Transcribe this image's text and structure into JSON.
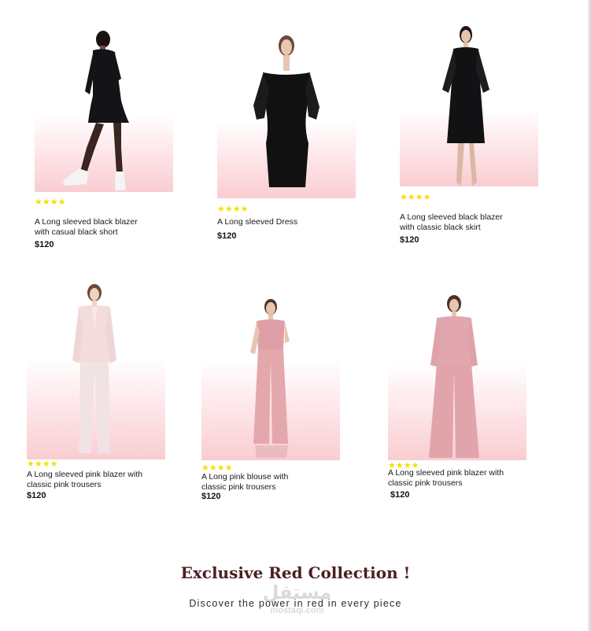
{
  "products": [
    {
      "stars": "★★★★",
      "title_line1": "A Long sleeved black blazer",
      "title_line2": "with  casual black short",
      "price": "$120"
    },
    {
      "stars": "★★★★",
      "title_line1": "A Long sleeved Dress",
      "title_line2": "",
      "price": "$120"
    },
    {
      "stars": "★★★★",
      "title_line1": "A Long sleeved black blazer",
      "title_line2": "with  classic black skirt",
      "price": "$120"
    },
    {
      "stars": "★★★★",
      "title_line1": "A Long sleeved pink blazer with",
      "title_line2": "classic pink trousers",
      "price": "$120"
    },
    {
      "stars": "★★★★",
      "title_line1": "A Long  pink blouse with",
      "title_line2": "classic pink trousers",
      "price": "$120"
    },
    {
      "stars": "★★★★",
      "title_line1": "A Long sleeved pink blazer with",
      "title_line2": "classic pink trousers",
      "price": "$120"
    }
  ],
  "collection": {
    "heading": "Exclusive Red Collection !",
    "subtitle": "Discover the power in red in every piece"
  },
  "watermark": {
    "arabic": "مستقل",
    "latin": "mostaqi.com"
  },
  "colors": {
    "star": "#f3e000",
    "heading": "#4a1f22",
    "photo_bg": "#fde3e6"
  }
}
